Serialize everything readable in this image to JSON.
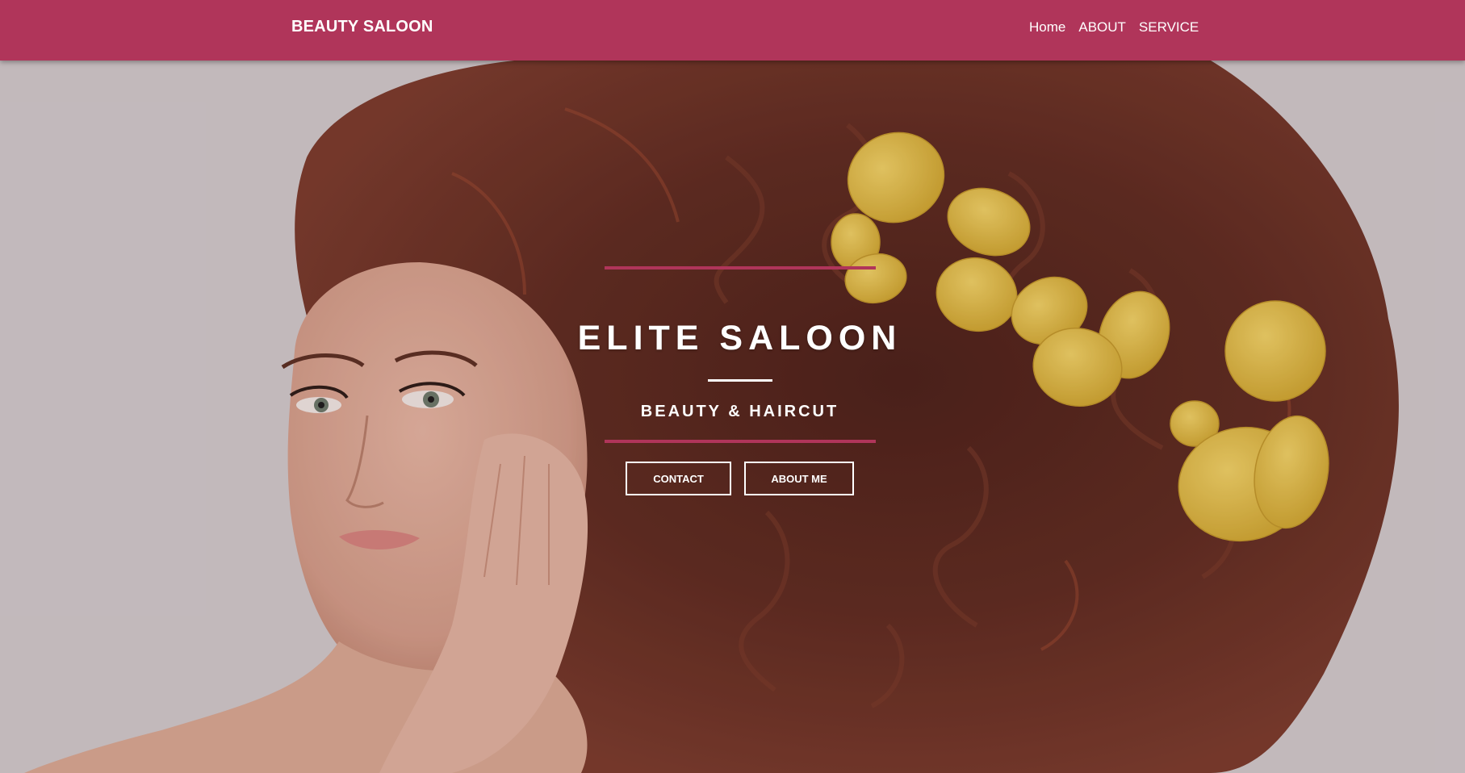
{
  "navbar": {
    "brand": "BEAUTY SALOON",
    "links": [
      "Home",
      "ABOUT",
      "SERVICE"
    ],
    "background_color": "#b0355a"
  },
  "hero": {
    "title": "ELITE SALOON",
    "subtitle": "BEAUTY & HAIRCUT",
    "buttons": {
      "contact": "CONTACT",
      "about": "ABOUT ME"
    },
    "accent_color": "#b0355a",
    "image_semantic": "woman-with-curly-red-hair-and-yellow-petals"
  }
}
